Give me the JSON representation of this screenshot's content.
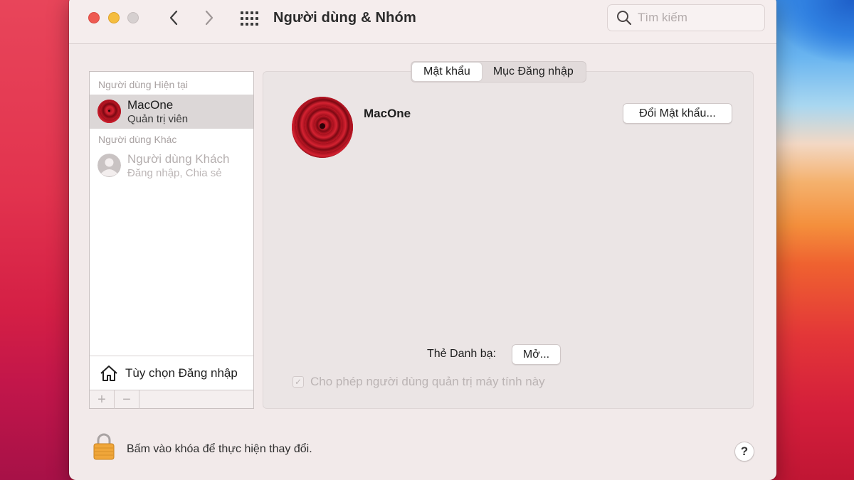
{
  "window": {
    "title": "Người dùng & Nhóm",
    "search_placeholder": "Tìm kiếm"
  },
  "sidebar": {
    "current_header": "Người dùng Hiện tại",
    "current_user": {
      "name": "MacOne",
      "role": "Quản trị viên"
    },
    "other_header": "Người dùng Khác",
    "guest_user": {
      "name": "Người dùng Khách",
      "role": "Đăng nhập, Chia sẻ"
    },
    "login_options": "Tùy chọn Đăng nhập",
    "add_label": "+",
    "remove_label": "−"
  },
  "tabs": [
    {
      "label": "Mật khẩu",
      "active": true
    },
    {
      "label": "Mục Đăng nhập",
      "active": false
    }
  ],
  "detail": {
    "user_name": "MacOne",
    "change_password": "Đổi Mật khẩu...",
    "contacts_card_label": "Thẻ Danh bạ:",
    "open_button": "Mở...",
    "allow_admin_label": "Cho phép người dùng quản trị máy tính này",
    "allow_admin_checked": true
  },
  "footer": {
    "lock_text": "Bấm vào khóa để thực hiện thay đổi.",
    "help_label": "?"
  },
  "colors": {
    "close": "#ee5a52",
    "minimize": "#f5bd3f",
    "zoom_disabled": "#d6d0d0",
    "lock": "#f0a63a"
  }
}
